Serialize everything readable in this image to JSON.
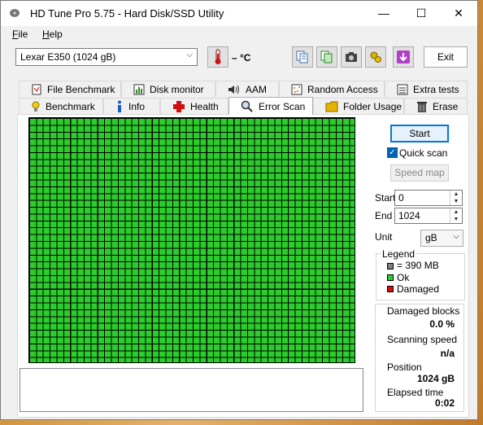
{
  "window": {
    "title": "HD Tune Pro 5.75 - Hard Disk/SSD Utility"
  },
  "title_buttons": {
    "minimize": "—",
    "maximize": "☐",
    "close": "✕"
  },
  "menu": {
    "file_first": "F",
    "file_rest": "ile",
    "help_first": "H",
    "help_rest": "elp"
  },
  "toolbar": {
    "drive": "Lexar   E350 (1024 gB)",
    "temperature": "– °C",
    "exit_label": "Exit",
    "icons": [
      "copy-info-icon",
      "copy-screenshot-icon",
      "camera-icon",
      "options-icon",
      "download-icon"
    ]
  },
  "tabs": {
    "row1": [
      "File Benchmark",
      "Disk monitor",
      "AAM",
      "Random Access",
      "Extra tests"
    ],
    "row2": [
      "Benchmark",
      "Info",
      "Health",
      "Error Scan",
      "Folder Usage",
      "Erase"
    ],
    "active": "Error Scan"
  },
  "scan": {
    "start_label": "Start",
    "quick_scan_label": "Quick scan",
    "quick_scan_checked": true,
    "speed_map_label": "Speed map",
    "start_field_label": "Start",
    "start_value": "0",
    "end_field_label": "End",
    "end_value": "1024",
    "unit_label": "Unit",
    "unit_value": "gB",
    "block_status": "all-ok"
  },
  "legend": {
    "title": "Legend",
    "items": [
      {
        "label": "= 390 MB",
        "color": "#808080"
      },
      {
        "label": "Ok",
        "color": "#2ccc2c"
      },
      {
        "label": "Damaged",
        "color": "#d01010"
      }
    ]
  },
  "stats": {
    "damaged_blocks_label": "Damaged blocks",
    "damaged_blocks_value": "0.0 %",
    "scanning_speed_label": "Scanning speed",
    "scanning_speed_value": "n/a",
    "position_label": "Position",
    "position_value": "1024 gB",
    "elapsed_time_label": "Elapsed time",
    "elapsed_time_value": "0:02"
  }
}
